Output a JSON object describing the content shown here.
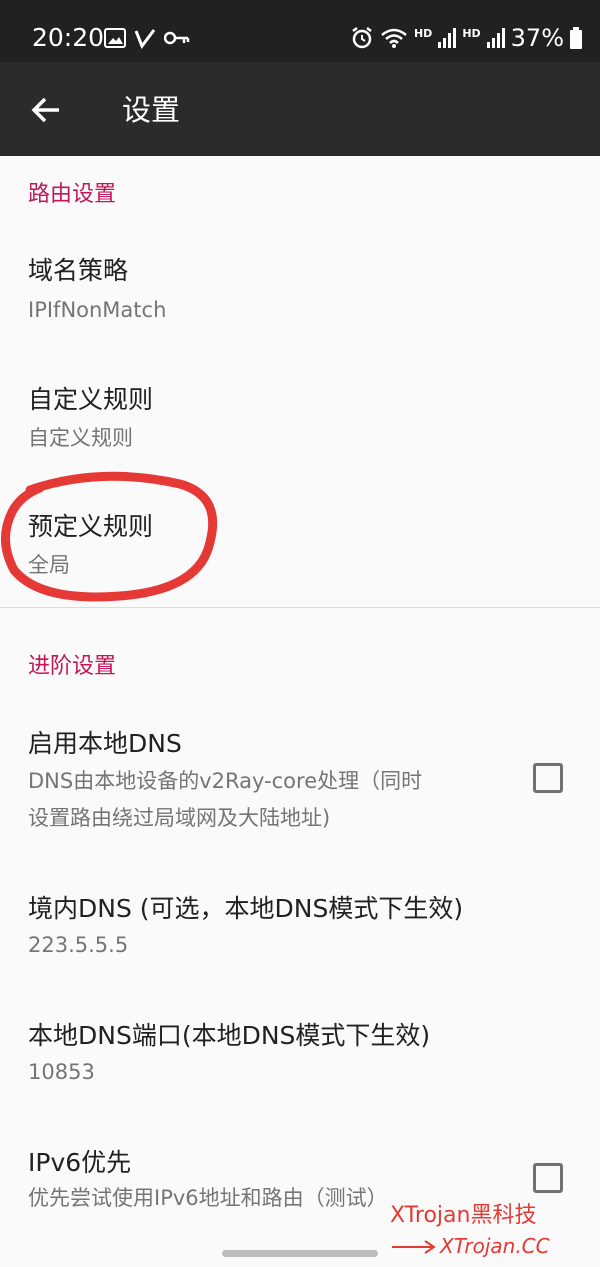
{
  "status_bar": {
    "time": "20:20",
    "hd1": "HD",
    "hd2": "HD",
    "battery": "37%"
  },
  "app_bar": {
    "title": "设置"
  },
  "routing": {
    "header": "路由设置",
    "domain_strategy": {
      "title": "域名策略",
      "summary": "IPIfNonMatch"
    },
    "custom_rules": {
      "title": "自定义规则",
      "summary": "自定义规则"
    },
    "predefined_rules": {
      "title": "预定义规则",
      "summary": "全局"
    }
  },
  "advanced": {
    "header": "进阶设置",
    "local_dns": {
      "title": "启用本地DNS",
      "summary_line1": "DNS由本地设备的v2Ray-core处理（同时",
      "summary_line2": "设置路由绕过局域网及大陆地址)",
      "checked": false
    },
    "domestic_dns": {
      "title": "境内DNS (可选，本地DNS模式下生效)",
      "summary": "223.5.5.5"
    },
    "local_dns_port": {
      "title": "本地DNS端口(本地DNS模式下生效)",
      "summary": "10853"
    },
    "ipv6": {
      "title": "IPv6优先",
      "summary": "优先尝试使用IPv6地址和路由（测试）",
      "checked": false
    }
  },
  "watermark": {
    "line1": "XTrojan黑科技",
    "line2": "XTrojan.CC"
  },
  "colors": {
    "accent": "#c2185b",
    "annotation": "#e53935",
    "app_bar": "#2b2b2b",
    "status_bar": "#212121"
  }
}
